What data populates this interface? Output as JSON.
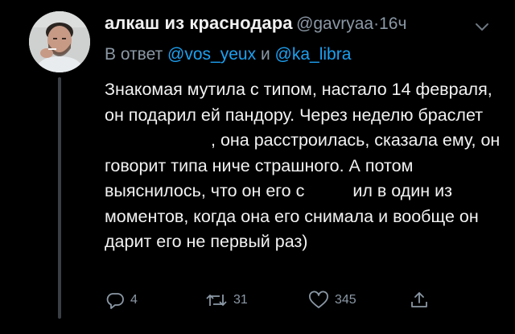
{
  "tweet": {
    "display_name": "алкаш из краснодара",
    "handle": "@gavryaa",
    "separator": "·",
    "time": "16ч",
    "reply_prefix": "В ответ",
    "reply_mention_1": "@vos_yeux",
    "reply_conjunction": "и",
    "reply_mention_2": "@ka_libra",
    "body": {
      "part1": "Знакомая мутила с типом, настало 14 февраля, он подарил ей пандору. Через неделю браслет ",
      "part2": ", она расстроилась, сказала ему, он говорит типа ниче страшного. А потом выяснилось, что он его с",
      "part3": "ил в один из моментов, когда она его снимала и вообще он дарит его не первый раз)"
    },
    "actions": {
      "replies": "4",
      "retweets": "31",
      "likes": "345"
    }
  },
  "icons": {
    "menu": "chevron-down-icon",
    "reply": "reply-icon",
    "retweet": "retweet-icon",
    "like": "heart-icon",
    "share": "share-icon"
  },
  "colors": {
    "background": "#000000",
    "text": "#f2f2f2",
    "secondary": "#8b98a5",
    "accent": "#1da1f2",
    "thread_line": "#3a3f45"
  }
}
